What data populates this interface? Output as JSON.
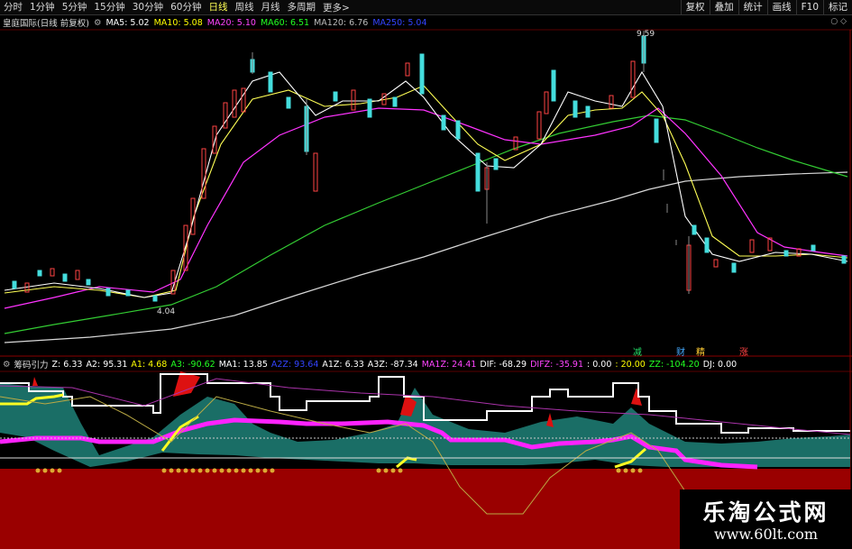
{
  "toolbar": {
    "timeframes": [
      "分时",
      "1分钟",
      "5分钟",
      "15分钟",
      "30分钟",
      "60分钟",
      "日线",
      "周线",
      "月线",
      "多周期"
    ],
    "more": "更多>",
    "right_buttons": [
      "复权",
      "叠加",
      "统计",
      "画线",
      "F10",
      "标记"
    ]
  },
  "main_legend": {
    "title": "皇庭国际(日线 前复权)",
    "ma5": "MA5: 5.02",
    "ma10": "MA10: 5.08",
    "ma20": "MA20: 5.10",
    "ma60": "MA60: 6.51",
    "ma120": "MA120: 6.76",
    "ma250": "MA250: 5.04",
    "colors": {
      "ma5": "#ffffff",
      "ma10": "#ffff00",
      "ma20": "#ff44ff",
      "ma60": "#00ff00",
      "ma120": "#aaaaaa",
      "ma250": "#3344ff"
    }
  },
  "price_labels": {
    "high": "9.59",
    "low": "4.04"
  },
  "signals": [
    "减",
    "财",
    "精",
    "涨"
  ],
  "sub_legend": {
    "title": "筹码引力",
    "z": "Z: 6.33",
    "a2": "A2: 95.31",
    "a1": "A1: 4.68",
    "a3": "A3: -90.62",
    "ma1": "MA1: 13.85",
    "a2z": "A2Z: 93.64",
    "a1z": "A1Z: 6.33",
    "a3z": "A3Z: -87.34",
    "ma1z": "MA1Z: 24.41",
    "dif": "DIF: -68.29",
    "difz": "DIFZ: -35.91",
    "zero": ": 0.00",
    "twenty": ": 20.00",
    "zz": "ZZ: -104.20",
    "dj": "DJ: 0.00"
  },
  "watermark": {
    "title": "乐淘公式网",
    "url": "www.60lt.com"
  }
}
